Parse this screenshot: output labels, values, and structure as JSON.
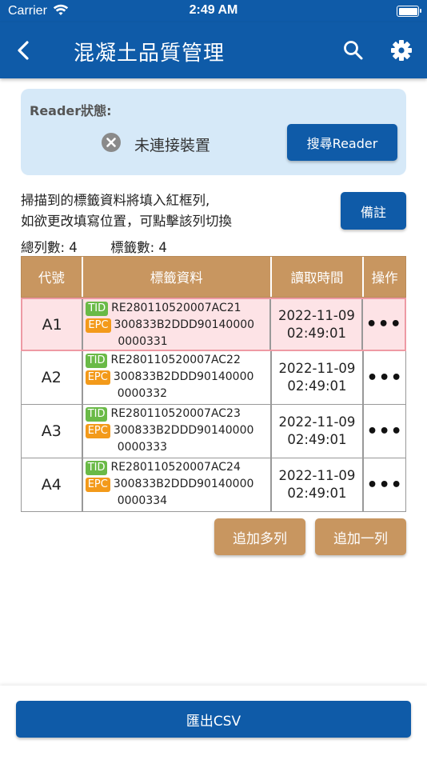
{
  "status_bar": {
    "carrier": "Carrier",
    "time": "2:49 AM"
  },
  "nav": {
    "title": "混凝土品質管理",
    "back_icon": "chevron-left-icon",
    "search_icon": "search-icon",
    "settings_icon": "gear-icon"
  },
  "reader": {
    "label": "Reader狀態:",
    "status": "未連接裝置",
    "status_icon": "close-circle-icon",
    "search_button": "搜尋Reader"
  },
  "instructions": {
    "line1": "掃描到的標籤資料將填入紅框列,",
    "line2": "如欲更改填寫位置，可點擊該列切換"
  },
  "memo_button": "備註",
  "counts": {
    "rows": "總列數: 4",
    "tags": "標籤數: 4"
  },
  "table": {
    "headers": {
      "code": "代號",
      "tag": "標籤資料",
      "time": "讀取時間",
      "ops": "操作"
    },
    "tid_badge": "TID",
    "epc_badge": "EPC",
    "rows": [
      {
        "code": "A1",
        "tid": "RE280110520007AC21",
        "epc1": "300833B2DDD90140000",
        "epc2": "0000331",
        "date": "2022-11-09",
        "time": "02:49:01",
        "ops": "•••"
      },
      {
        "code": "A2",
        "tid": "RE280110520007AC22",
        "epc1": "300833B2DDD90140000",
        "epc2": "0000332",
        "date": "2022-11-09",
        "time": "02:49:01",
        "ops": "•••"
      },
      {
        "code": "A3",
        "tid": "RE280110520007AC23",
        "epc1": "300833B2DDD90140000",
        "epc2": "0000333",
        "date": "2022-11-09",
        "time": "02:49:01",
        "ops": "•••"
      },
      {
        "code": "A4",
        "tid": "RE280110520007AC24",
        "epc1": "300833B2DDD90140000",
        "epc2": "0000334",
        "date": "2022-11-09",
        "time": "02:49:01",
        "ops": "•••"
      }
    ]
  },
  "buttons": {
    "add_multiple": "追加多列",
    "add_one": "追加一列",
    "export_csv": "匯出CSV"
  },
  "colors": {
    "primary": "#0f5ba8",
    "header_brown": "#c89660",
    "selected_row": "#fde3e6",
    "tid_green": "#6aba47",
    "epc_orange": "#f39a1a",
    "reader_card": "#d6e9f8"
  }
}
